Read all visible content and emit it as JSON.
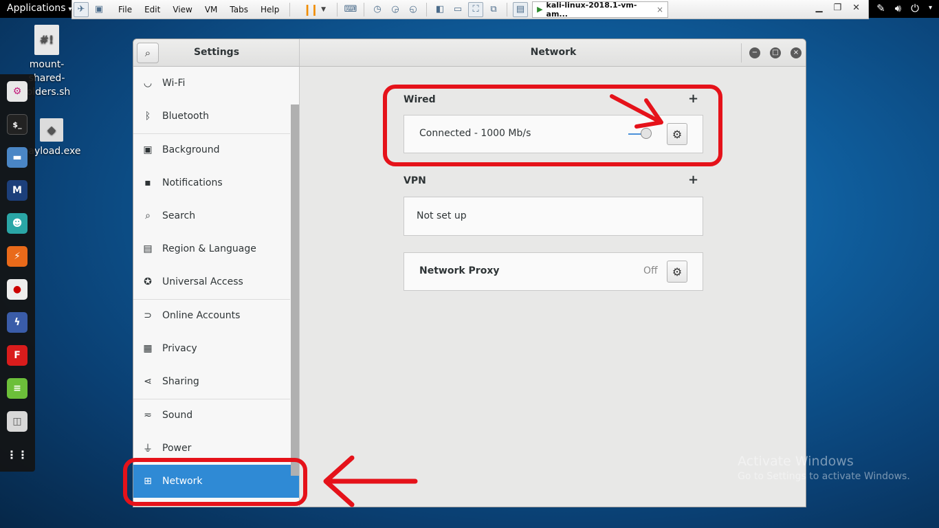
{
  "topbar": {
    "applications": "Applications"
  },
  "vmware": {
    "menu": [
      "File",
      "Edit",
      "View",
      "VM",
      "Tabs",
      "Help"
    ],
    "tab_title": "kali-linux-2018.1-vm-am...",
    "tab_close": "×"
  },
  "desktop": {
    "icons": [
      {
        "label": "mount-shared-folders.sh",
        "line1": "mount-",
        "line2": "shared-",
        "line3": "folders.sh"
      },
      {
        "label": "payload.exe"
      }
    ]
  },
  "settings": {
    "header": {
      "left_title": "Settings",
      "panel_title": "Network"
    },
    "sidebar": {
      "items": [
        {
          "label": "Wi-Fi",
          "icon": "wifi-icon"
        },
        {
          "label": "Bluetooth",
          "icon": "bluetooth-icon"
        },
        {
          "label": "Background",
          "icon": "background-icon"
        },
        {
          "label": "Notifications",
          "icon": "notifications-icon"
        },
        {
          "label": "Search",
          "icon": "search-icon"
        },
        {
          "label": "Region & Language",
          "icon": "region-icon"
        },
        {
          "label": "Universal Access",
          "icon": "universal-access-icon"
        },
        {
          "label": "Online Accounts",
          "icon": "online-accounts-icon"
        },
        {
          "label": "Privacy",
          "icon": "privacy-icon"
        },
        {
          "label": "Sharing",
          "icon": "sharing-icon"
        },
        {
          "label": "Sound",
          "icon": "sound-icon"
        },
        {
          "label": "Power",
          "icon": "power-icon"
        },
        {
          "label": "Network",
          "icon": "network-icon",
          "active": true
        }
      ]
    },
    "network": {
      "wired": {
        "title": "Wired",
        "add": "+",
        "status": "Connected - 1000 Mb/s",
        "enabled": true
      },
      "vpn": {
        "title": "VPN",
        "add": "+",
        "status": "Not set up"
      },
      "proxy": {
        "title": "Network Proxy",
        "state": "Off"
      }
    }
  },
  "watermark": {
    "line1": "Activate Windows",
    "line2": "Go to Settings to activate Windows."
  },
  "colors": {
    "accent": "#2f8ad5",
    "highlight": "#e5121a"
  }
}
